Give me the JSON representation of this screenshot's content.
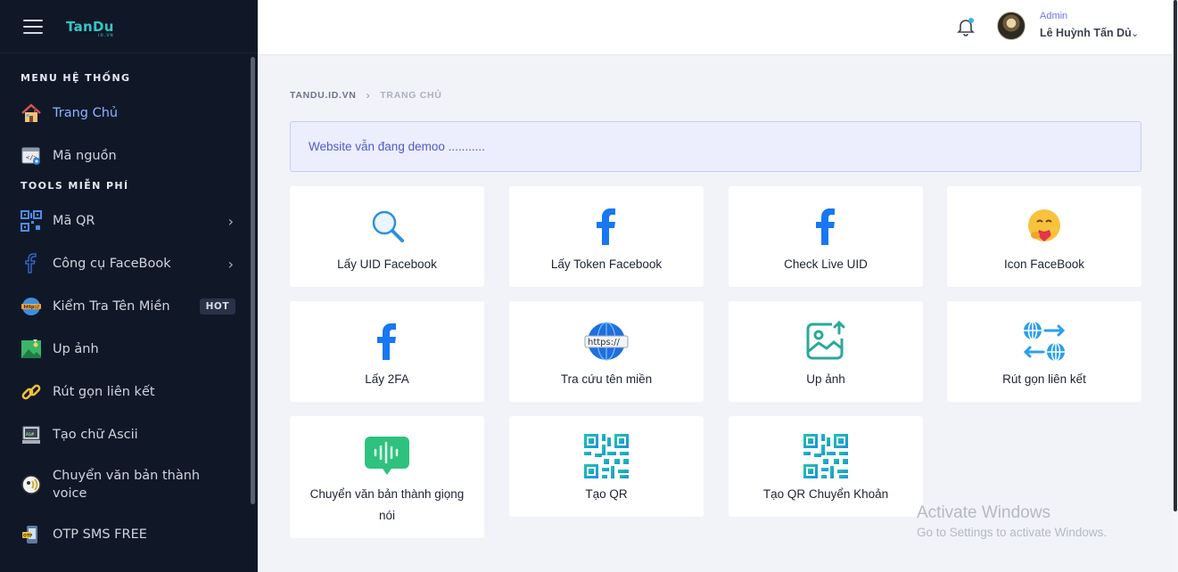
{
  "brand": {
    "name": "TanDu",
    "sub": "ID.VN"
  },
  "sidebar": {
    "sections": [
      "MENU HỆ THỐNG",
      "TOOLS MIỄN PHÍ"
    ],
    "items": [
      {
        "label": "Trang Chủ",
        "icon": "house-icon"
      },
      {
        "label": "Mã nguồn",
        "icon": "source-code-icon"
      },
      {
        "label": "Mã QR",
        "icon": "qr-code-icon"
      },
      {
        "label": "Công cụ FaceBook",
        "icon": "facebook-icon"
      },
      {
        "label": "Kiểm Tra Tên Miền",
        "icon": "http-globe-icon",
        "badge": "HOT"
      },
      {
        "label": "Up ảnh",
        "icon": "image-icon"
      },
      {
        "label": "Rút gọn liên kết",
        "icon": "link-icon"
      },
      {
        "label": "Tạo chữ Ascii",
        "icon": "ascii-icon"
      },
      {
        "label": "Chuyển văn bản thành voice",
        "label_line1": "Chuyển văn bản thành",
        "label_line2": "voice",
        "icon": "voice-icon"
      },
      {
        "label": "OTP SMS FREE",
        "icon": "otp-icon"
      }
    ]
  },
  "topbar": {
    "role": "Admin",
    "user_name": "Lê Huỳnh Tấn Dủ"
  },
  "breadcrumb": {
    "home": "TANDU.ID.VN",
    "current": "TRANG CHỦ"
  },
  "alert": {
    "text": "Website vẫn đang demoo ..........."
  },
  "cards": [
    {
      "label": "Lấy UID Facebook",
      "icon": "search-icon"
    },
    {
      "label": "Lấy Token Facebook",
      "icon": "facebook-icon"
    },
    {
      "label": "Check Live UID",
      "icon": "facebook-icon"
    },
    {
      "label": "Icon FaceBook",
      "icon": "hug-emoji-icon"
    },
    {
      "label": "Lấy 2FA",
      "icon": "facebook-icon"
    },
    {
      "label": "Tra cứu tên miền",
      "icon": "https-globe-icon"
    },
    {
      "label": "Up ảnh",
      "icon": "image-upload-icon"
    },
    {
      "label": "Rút gọn liên kết",
      "icon": "globe-exchange-icon"
    },
    {
      "label": "Chuyển văn bản thành giọng nói",
      "icon": "voice-message-icon"
    },
    {
      "label": "Tạo QR",
      "icon": "qr-code-icon"
    },
    {
      "label": "Tạo QR Chuyển Khoản",
      "icon": "qr-code-icon"
    }
  ],
  "watermark": {
    "title": "Activate Windows",
    "subtitle": "Go to Settings to activate Windows."
  },
  "colors": {
    "sidebar_bg": "#101828",
    "accent": "#6b76e6",
    "brand": "#36c6c4",
    "facebook": "#1877f2"
  }
}
